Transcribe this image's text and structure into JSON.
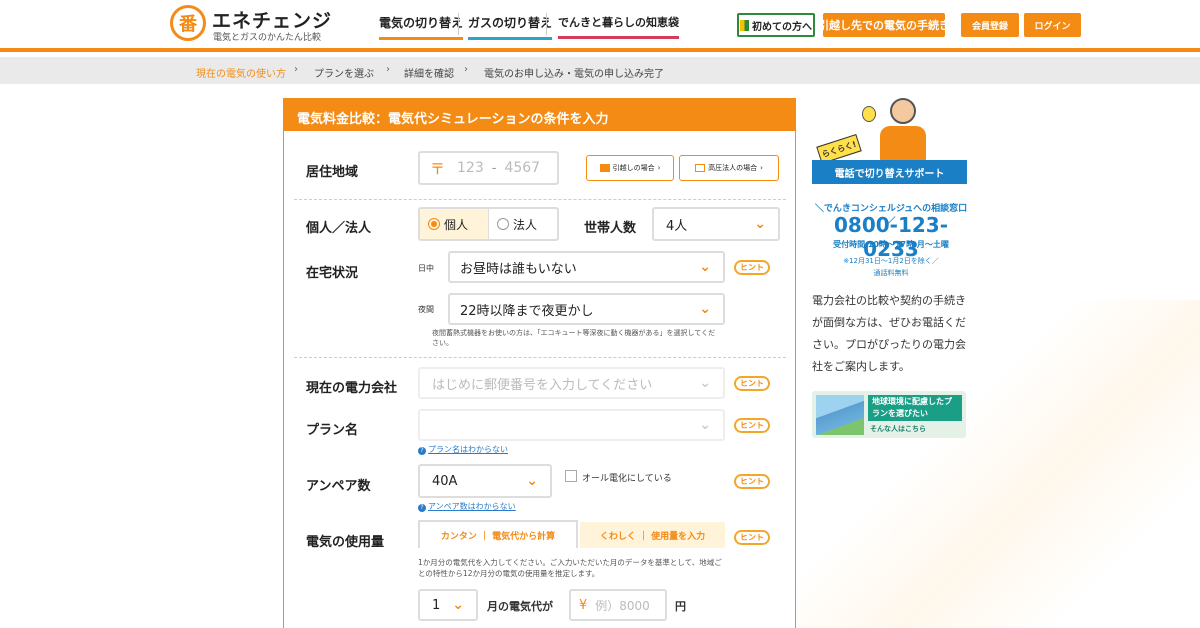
{
  "header": {
    "logo_mark": "番",
    "logo_name": "エネチェンジ",
    "logo_tagline": "電気とガスのかんたん比較",
    "nav": [
      "電気の切り替え",
      "ガスの切り替え",
      "でんきと暮らしの知恵袋"
    ],
    "buttons": {
      "beginner": "初めての方へ",
      "moving": "引越し先での電気の手続き",
      "register": "会員登録",
      "login": "ログイン"
    }
  },
  "breadcrumb": [
    "現在の電気の使い方",
    "プランを選ぶ",
    "詳細を確認",
    "電気のお申し込み・電気の申し込み完了"
  ],
  "form": {
    "title": "電気料金比較：電気代シミュレーションの条件を入力",
    "address": {
      "label": "居住地域",
      "postal_mark": "〒",
      "zip1_placeholder": "123",
      "zip2_placeholder": "4567",
      "moving_button": "引越しの場合",
      "corp_button": "高圧法人の場合"
    },
    "type": {
      "label": "個人／法人",
      "option_personal": "個人",
      "option_corp": "法人",
      "selected": "個人"
    },
    "household": {
      "label": "世帯人数",
      "value": "4人"
    },
    "home": {
      "label": "在宅状況",
      "day_label": "日中",
      "day_value": "お昼時は誰もいない",
      "night_label": "夜間",
      "night_value": "22時以降まで夜更かし",
      "note": "夜間蓄熱式機器をお使いの方は、「エコキュート等深夜に動く機器がある」を選択してください。"
    },
    "company": {
      "label": "現在の電力会社",
      "placeholder": "はじめに郵便番号を入力してください"
    },
    "plan": {
      "label": "プラン名",
      "value": "",
      "help_link": "プラン名はわからない"
    },
    "ampere": {
      "label": "アンペア数",
      "value": "40A",
      "all_electric": "オール電化にしている",
      "help_link": "アンペア数はわからない"
    },
    "usage": {
      "label": "電気の使用量",
      "tab_simple": "カンタン ｜ 電気代から計算",
      "tab_detail": "くわしく ｜ 使用量を入力",
      "description": "1か月分の電気代を入力してください。ご入力いただいた月のデータを基準として、地域ごとの特性から12か月分の電気の使用量を推定します。",
      "month_value": "1",
      "month_suffix": "月の電気代が",
      "yen_mark": "¥",
      "amount_placeholder": "例）8000",
      "unit": "円"
    },
    "hint": "ヒント"
  },
  "sidebar": {
    "badge": "らくらく!",
    "banner": "電話で切り替えサポート",
    "concierge": "＼でんきコンシェルジュへの相談窓口／",
    "phone": "0800-123-0233",
    "hours": "受付時間 10時〜17時 月〜土曜",
    "note1": "※12月31日〜1月2日を除く／",
    "note2": "通話料無料",
    "description": "電力会社の比較や契約の手続きが面倒な方は、ぜひお電話ください。プロがぴったりの電力会社をご案内します。",
    "eco_title": "地球環境に配慮したプランを選びたい",
    "eco_link": "そんな人はこちら"
  },
  "colors": {
    "accent": "#f38b14",
    "blue": "#1a7fc4",
    "green": "#2d8a3a"
  }
}
